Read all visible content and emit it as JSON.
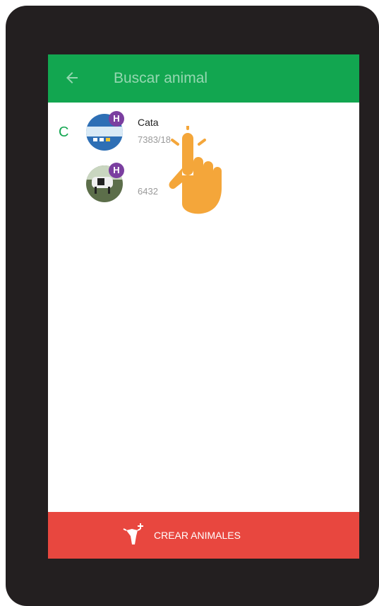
{
  "appbar": {
    "title": "Buscar animal",
    "back_icon": "arrow-left-icon"
  },
  "list": {
    "section_letter": "C",
    "items": [
      {
        "name": "Cata",
        "id": "7383/18",
        "badge": "H",
        "avatar_icon": "cow-photo"
      },
      {
        "name": "",
        "id": "6432",
        "badge": "H",
        "avatar_icon": "cow-photo"
      }
    ]
  },
  "bottom_button": {
    "label": "CREAR ANIMALES",
    "icon": "cow-plus-icon"
  },
  "colors": {
    "appbar": "#12a650",
    "bottom": "#e8473f",
    "badge": "#7b3fa0",
    "hand": "#f4a63a"
  }
}
